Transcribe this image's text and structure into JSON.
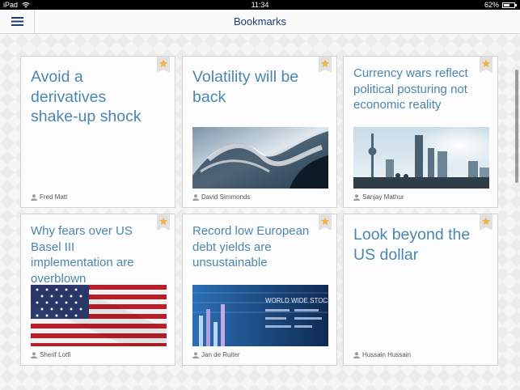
{
  "statusbar": {
    "device": "iPad",
    "time": "11:34",
    "battery": "62%",
    "battery_level": 0.62
  },
  "navbar": {
    "title": "Bookmarks",
    "menu_icon": "hamburger-icon"
  },
  "colors": {
    "title": "#4b86ad",
    "nav_title": "#1b3e6e",
    "ribbon": "#e1e1e1",
    "star": "#f2b23a"
  },
  "cards": [
    {
      "title": "Avoid a derivatives shake-up shock",
      "author": "Fred Matt",
      "image": "none"
    },
    {
      "title": "Volatility will be back",
      "author": "David Simmonds",
      "image": "wave"
    },
    {
      "title": "Currency wars reflect political posturing not economic reality",
      "author": "Sanjay Mathur",
      "image": "skyline"
    },
    {
      "title": "Why fears over US Basel III implementation are overblown",
      "author": "Sherif Lotfi",
      "image": "us-flag"
    },
    {
      "title": "Record low European debt yields are unsustainable",
      "author": "Jan de Ruiter",
      "image": "stock-board",
      "image_text": "WORLD WIDE STOCK"
    },
    {
      "title": "Look beyond the US dollar",
      "author": "Hussain Hussain",
      "image": "none"
    }
  ]
}
